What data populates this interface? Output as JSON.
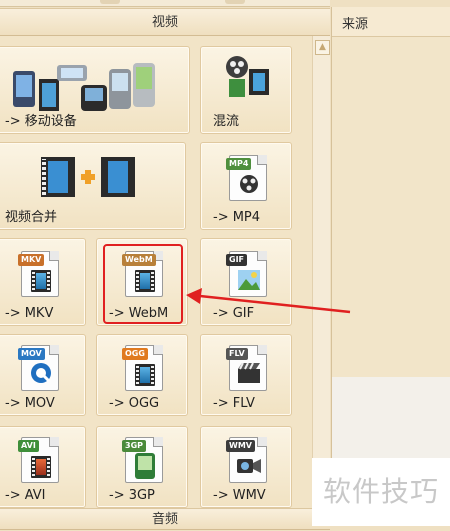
{
  "sections": {
    "video": "视频",
    "audio": "音频"
  },
  "source_panel": {
    "title": "来源"
  },
  "tiles": {
    "mobile": "-> 移动设备",
    "mux": "混流",
    "merge": "视频合并",
    "mp4": "-> MP4",
    "mkv": "-> MKV",
    "webm": "-> WebM",
    "gif": "-> GIF",
    "mov": "-> MOV",
    "ogg": "-> OGG",
    "flv": "-> FLV",
    "avi": "-> AVI",
    "3gp": "-> 3GP",
    "wmv": "-> WMV"
  },
  "badges": {
    "mp4": "MP4",
    "mkv": "MKV",
    "webm": "WebM",
    "gif": "GIF",
    "mov": "MOV",
    "ogg": "OGG",
    "flv": "FLV",
    "avi": "AVI",
    "3gp": "3GP",
    "wmv": "WMV"
  },
  "watermark": "软件技巧",
  "colors": {
    "highlight": "#e02020",
    "background": "#efe0c2"
  },
  "icons": [
    "film-icon",
    "phone-icon",
    "plus-icon",
    "scroll-up-icon"
  ]
}
